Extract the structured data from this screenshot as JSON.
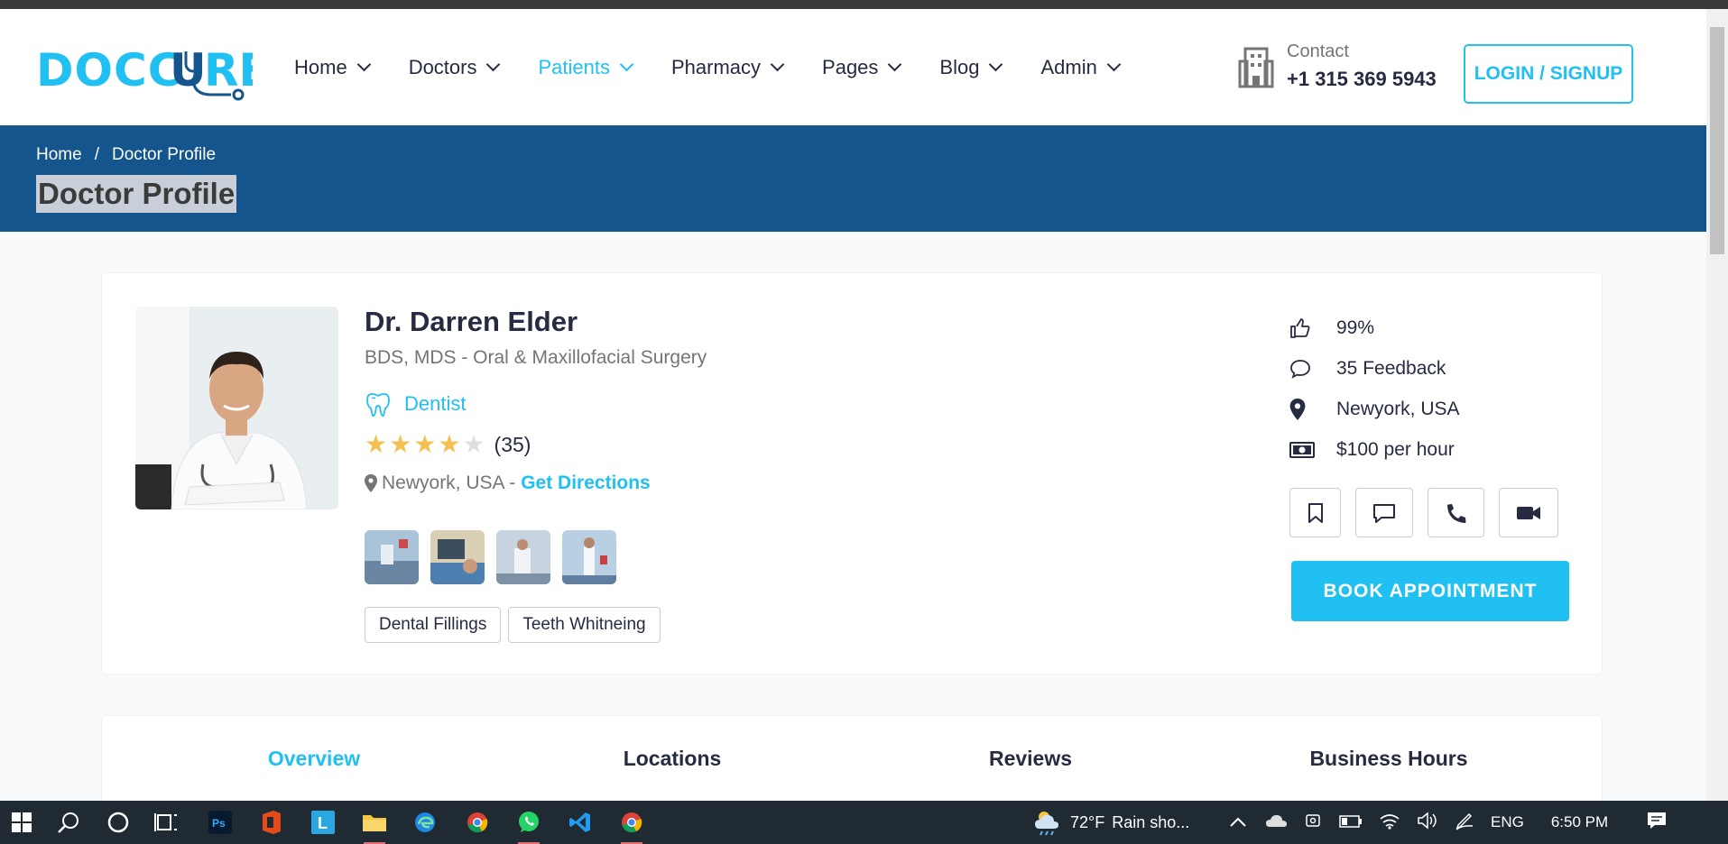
{
  "header": {
    "logo": "DOCCURE",
    "nav": [
      {
        "label": "Home",
        "active": false
      },
      {
        "label": "Doctors",
        "active": false
      },
      {
        "label": "Patients",
        "active": true
      },
      {
        "label": "Pharmacy",
        "active": false
      },
      {
        "label": "Pages",
        "active": false
      },
      {
        "label": "Blog",
        "active": false
      },
      {
        "label": "Admin",
        "active": false
      }
    ],
    "contact_label": "Contact",
    "contact_phone": "+1 315 369 5943",
    "login_label": "LOGIN / SIGNUP"
  },
  "breadcrumb": {
    "items": [
      "Home",
      "Doctor Profile"
    ],
    "separator": "/",
    "title": "Doctor Profile"
  },
  "doctor": {
    "name": "Dr. Darren Elder",
    "degree": "BDS, MDS - Oral & Maxillofacial Surgery",
    "speciality": "Dentist",
    "rating": 4,
    "rating_max": 5,
    "review_count": "(35)",
    "location": "Newyork, USA - ",
    "directions_label": "Get Directions",
    "services": [
      "Dental Fillings",
      "Teeth Whitneing"
    ],
    "gallery_count": 4
  },
  "stats": {
    "likes": "99%",
    "feedback": "35 Feedback",
    "location": "Newyork, USA",
    "price": "$100 per hour"
  },
  "book_label": "BOOK APPOINTMENT",
  "tabs": [
    {
      "label": "Overview",
      "active": true
    },
    {
      "label": "Locations",
      "active": false
    },
    {
      "label": "Reviews",
      "active": false
    },
    {
      "label": "Business Hours",
      "active": false
    }
  ],
  "taskbar": {
    "weather_temp": "72°F",
    "weather_desc": "Rain sho...",
    "language": "ENG",
    "time": "6:50 PM"
  },
  "colors": {
    "accent": "#20c0f3",
    "brand_dark": "#15558d",
    "text": "#272b41",
    "muted": "#757575",
    "star": "#f4c150"
  }
}
